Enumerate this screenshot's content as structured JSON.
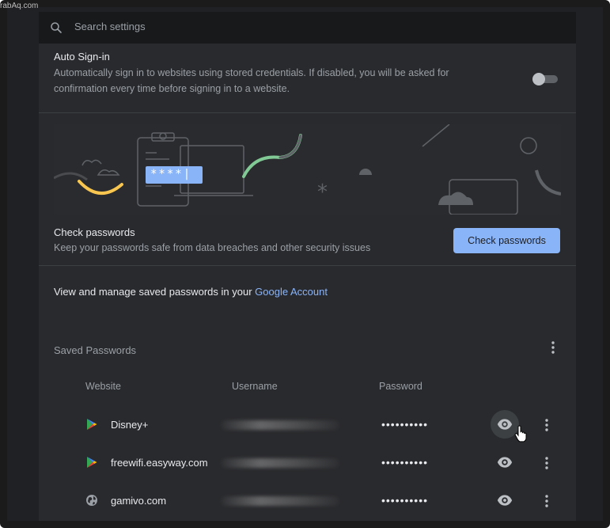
{
  "watermark": "rabAq.com",
  "search": {
    "placeholder": "Search settings",
    "icon": "search-icon"
  },
  "auto_signin": {
    "title": "Auto Sign-in",
    "description_line1": "Automatically sign in to websites using stored credentials. If disabled, you will be asked for",
    "description_line2": "confirmation every time before signing in to a website.",
    "enabled": false
  },
  "illustration": {
    "password_text": "****|"
  },
  "check_passwords": {
    "title": "Check passwords",
    "description": "Keep your passwords safe from data breaches and other security issues",
    "button_label": "Check passwords"
  },
  "manage": {
    "text": "View and manage saved passwords in your ",
    "link": "Google Account"
  },
  "saved_passwords": {
    "title": "Saved Passwords",
    "columns": {
      "website": "Website",
      "username": "Username",
      "password": "Password"
    },
    "rows": [
      {
        "site": "Disney+",
        "icon": "play-store-icon",
        "password_mask": "••••••••••"
      },
      {
        "site": "freewifi.easyway.com",
        "icon": "play-store-icon",
        "password_mask": "••••••••••"
      },
      {
        "site": "gamivo.com",
        "icon": "globe-icon",
        "password_mask": "••••••••••"
      }
    ]
  },
  "colors": {
    "accent": "#8ab4f8",
    "background": "#202124",
    "card": "#292a2d"
  }
}
